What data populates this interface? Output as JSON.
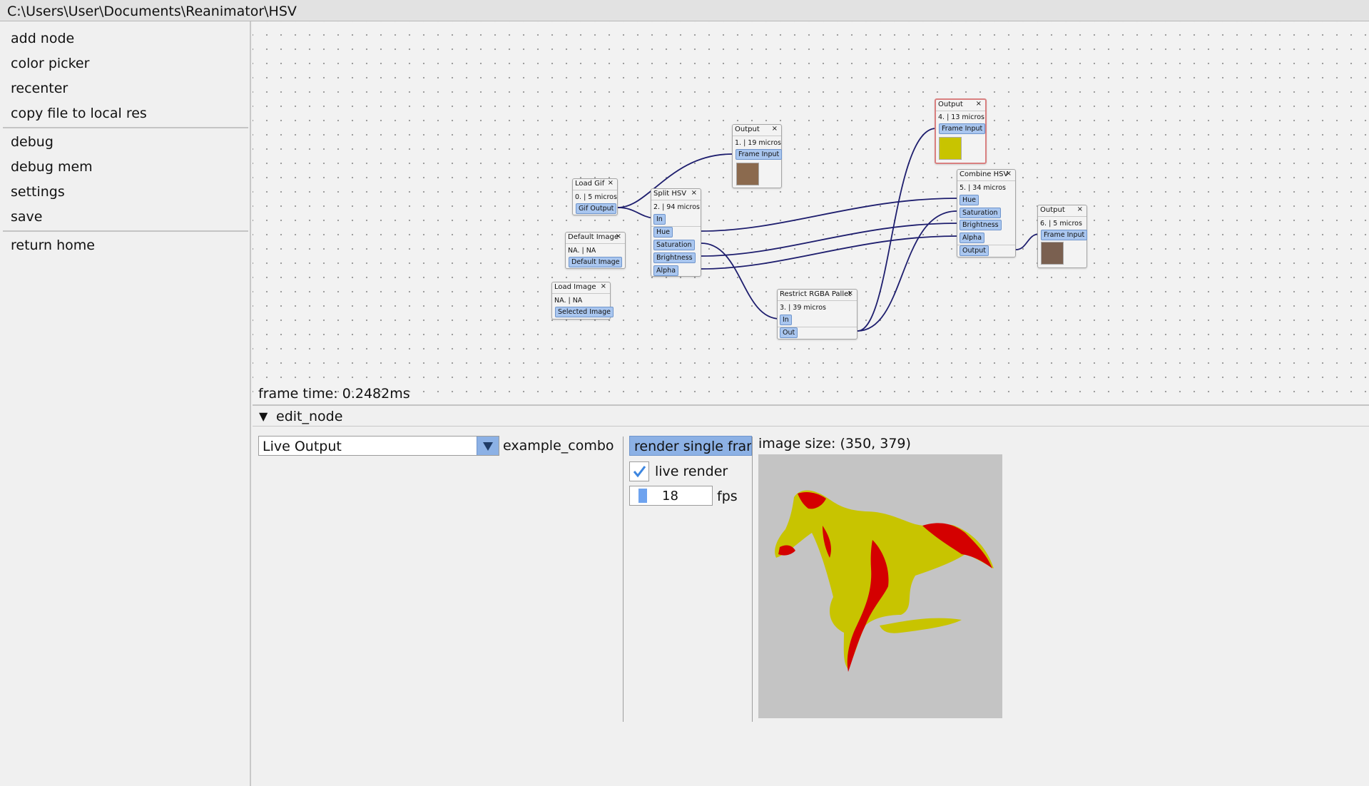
{
  "window": {
    "title": "C:\\Users\\User\\Documents\\Reanimator\\HSV"
  },
  "sidebar": {
    "items": [
      {
        "label": "add node"
      },
      {
        "label": "color picker"
      },
      {
        "label": "recenter"
      },
      {
        "label": "copy file to local res"
      },
      {
        "label": "debug"
      },
      {
        "label": "debug mem"
      },
      {
        "label": "settings"
      },
      {
        "label": "save"
      },
      {
        "label": "return home"
      }
    ]
  },
  "graph": {
    "frame_time": "frame time: 0.2482ms",
    "nodes": {
      "load_gif": {
        "title": "Load Gif",
        "close": "×",
        "timing": "0. | 5 micros",
        "pins": [
          "Gif Output"
        ]
      },
      "default_image": {
        "title": "Default Image",
        "close": "×",
        "timing": "NA. | NA",
        "pins": [
          "Default Image"
        ]
      },
      "load_image": {
        "title": "Load Image",
        "close": "×",
        "timing": "NA. | NA",
        "pins": [
          "Selected Image"
        ]
      },
      "split_hsv": {
        "title": "Split HSV",
        "close": "×",
        "timing": "2. | 94 micros",
        "pins": [
          "In",
          "Hue",
          "Saturation",
          "Brightness",
          "Alpha"
        ]
      },
      "output_1": {
        "title": "Output",
        "close": "×",
        "timing": "1. | 19 micros",
        "pins": [
          "Frame Input"
        ]
      },
      "restrict_rgba": {
        "title": "Restrict RGBA Pallet",
        "close": "×",
        "timing": "3. | 39 micros",
        "pins": [
          "In",
          "Out"
        ]
      },
      "output_4": {
        "title": "Output",
        "close": "×",
        "timing": "4. | 13 micros",
        "pins": [
          "Frame Input"
        ]
      },
      "combine_hsv": {
        "title": "Combine HSV",
        "close": "×",
        "timing": "5. | 34 micros",
        "pins": [
          "Hue",
          "Saturation",
          "Brightness",
          "Alpha",
          "Output"
        ]
      },
      "output_6": {
        "title": "Output",
        "close": "×",
        "timing": "6. | 5 micros",
        "pins": [
          "Frame Input"
        ]
      }
    }
  },
  "edit_node": {
    "header": "edit_node",
    "combo": {
      "value": "Live Output",
      "label": "example_combo"
    },
    "render_button": "render single frame",
    "live_render": {
      "label": "live render",
      "checked": true
    },
    "fps": {
      "value": "18",
      "label": "fps"
    },
    "image_size": "image size: (350, 379)"
  },
  "colors": {
    "accent": "#8cb1e5",
    "wire": "#1e1e6e",
    "selected_border": "#d98080",
    "preview_red": "#d40000",
    "preview_yellow": "#c8c400"
  }
}
